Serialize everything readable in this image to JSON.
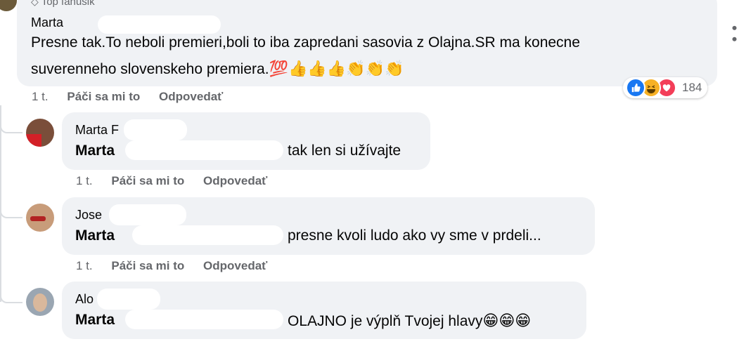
{
  "top_comment": {
    "badge_label": "Top fanúšik",
    "author": "Marta",
    "text_line1": "Presne tak.To neboli premieri,boli to iba zapredani sasovia z Olajna.SR ma konecne",
    "text_line2": "suverenneho slovenskeho premiera.",
    "emojis": [
      "💯",
      "👍",
      "👍",
      "👍",
      "👏",
      "👏",
      "👏"
    ],
    "time": "1 t.",
    "like_label": "Páči sa mi to",
    "reply_label": "Odpovedať",
    "reaction_count": "184",
    "reaction_icons": [
      "like-icon",
      "haha-icon",
      "love-icon"
    ],
    "more_icon": "more-options-icon"
  },
  "replies": [
    {
      "author": "Marta F",
      "mention": "Marta",
      "text": "tak len si užívajte",
      "time": "1 t.",
      "like_label": "Páči sa mi to",
      "reply_label": "Odpovedať"
    },
    {
      "author": "Jose",
      "mention": "Marta",
      "text": "presne kvoli ludo ako vy sme v prdeli...",
      "time": "1 t.",
      "like_label": "Páči sa mi to",
      "reply_label": "Odpovedať"
    },
    {
      "author": "Alo",
      "mention": "Marta",
      "text": "OLAJNO je výplň Tvojej hlavy",
      "emojis": [
        "😁",
        "😁",
        "😁"
      ]
    }
  ],
  "colors": {
    "bubble_bg": "#f0f2f5",
    "secondary_text": "#65676b",
    "like_blue": "#1877f2",
    "love_red": "#f33e58",
    "haha_yellow": "#f7b125"
  }
}
